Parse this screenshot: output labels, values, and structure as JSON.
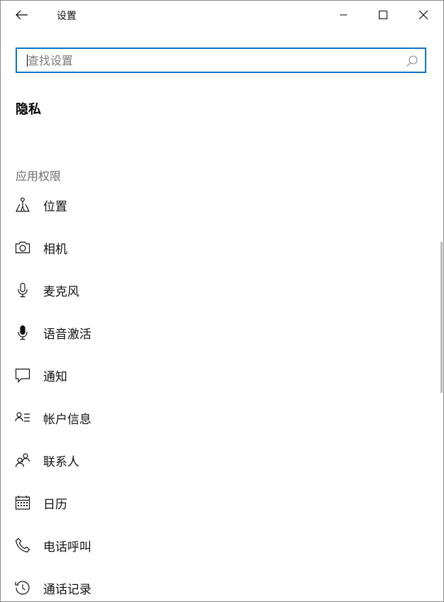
{
  "window": {
    "title": "设置"
  },
  "search": {
    "placeholder": "查找设置",
    "value": ""
  },
  "page": {
    "title": "隐私"
  },
  "section": {
    "header": "应用权限"
  },
  "nav": {
    "items": [
      {
        "label": "位置",
        "icon": "location-icon"
      },
      {
        "label": "相机",
        "icon": "camera-icon"
      },
      {
        "label": "麦克风",
        "icon": "microphone-icon"
      },
      {
        "label": "语音激活",
        "icon": "voice-activation-icon"
      },
      {
        "label": "通知",
        "icon": "notification-icon"
      },
      {
        "label": "帐户信息",
        "icon": "account-info-icon"
      },
      {
        "label": "联系人",
        "icon": "contacts-icon"
      },
      {
        "label": "日历",
        "icon": "calendar-icon"
      },
      {
        "label": "电话呼叫",
        "icon": "phone-icon"
      },
      {
        "label": "通话记录",
        "icon": "call-history-icon"
      }
    ]
  },
  "colors": {
    "accent": "#0a75c8",
    "section_header": "#6b6b6b"
  }
}
